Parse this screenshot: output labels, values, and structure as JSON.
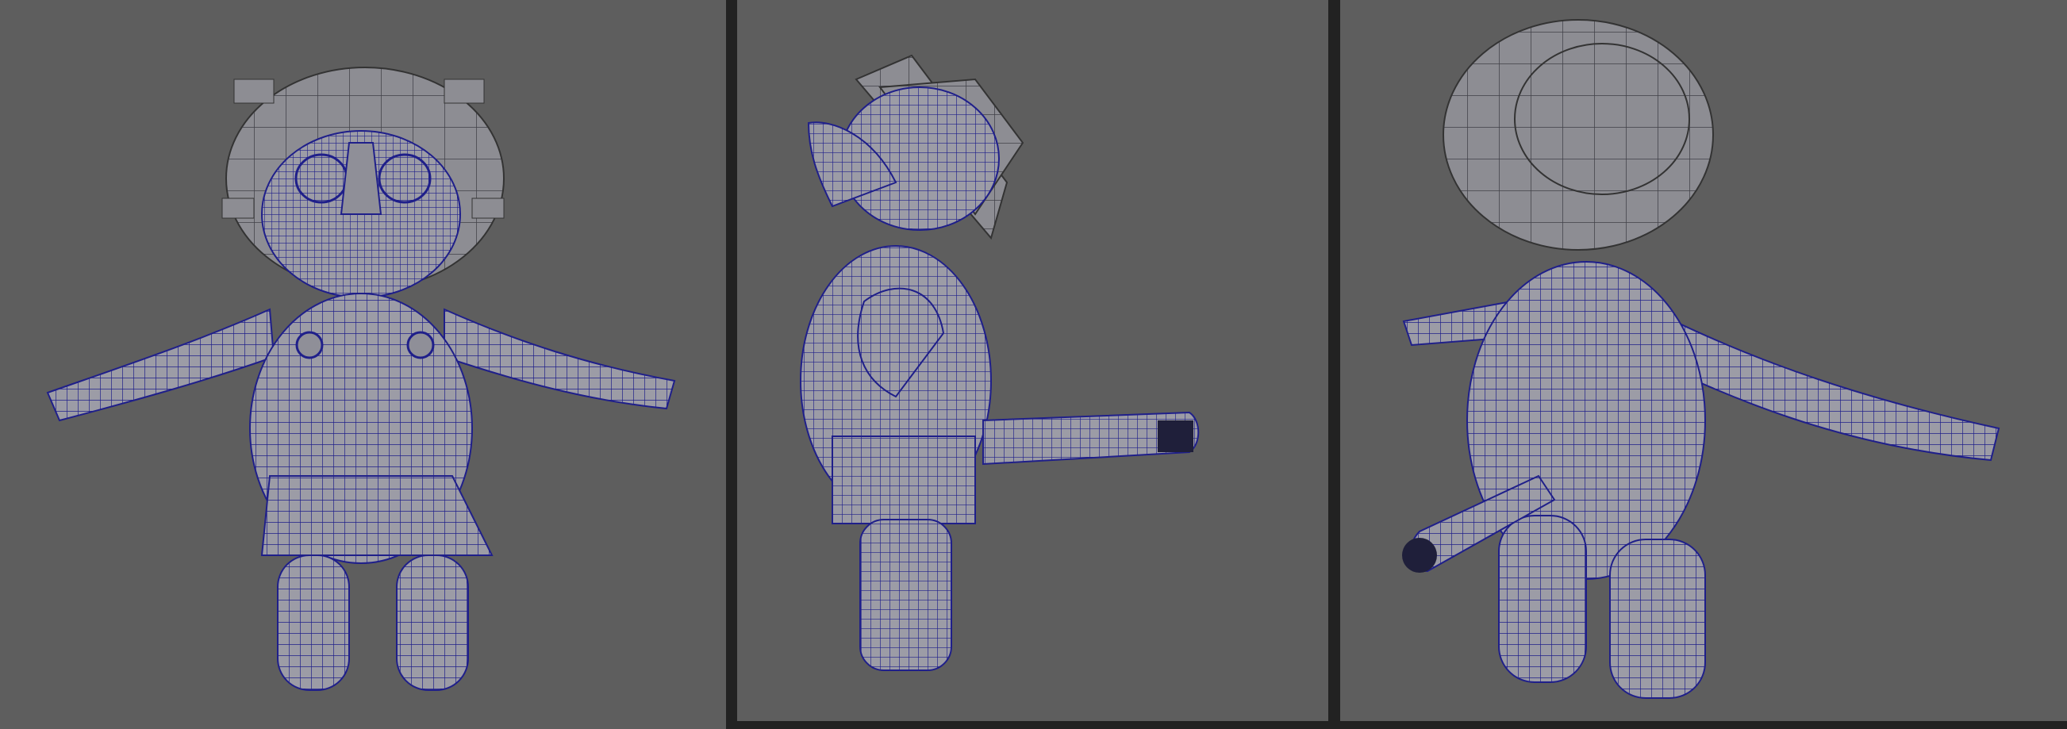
{
  "app": {
    "description_visible_text": ""
  },
  "viewports": [
    {
      "id": "front",
      "view": "front"
    },
    {
      "id": "side",
      "view": "side"
    },
    {
      "id": "persp",
      "view": "perspective"
    }
  ],
  "colors": {
    "background": "#5e5e5e",
    "separator": "#222222",
    "mesh_fill": "#9a9aa2",
    "wireframe": "#1f1f8a"
  }
}
